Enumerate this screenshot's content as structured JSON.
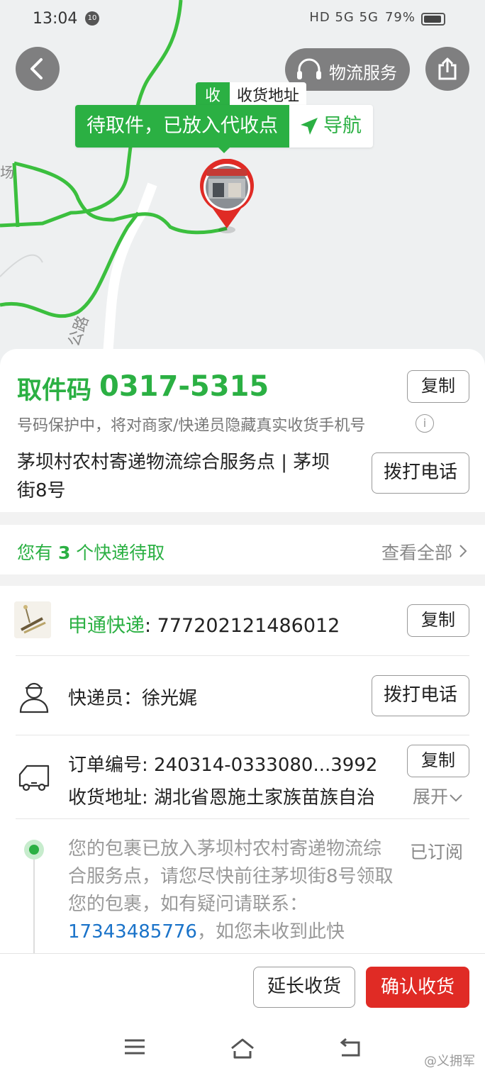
{
  "status_bar": {
    "time": "13:04",
    "notification_badge": "10",
    "system_indicators": "HD 5G 5G",
    "battery": "79%"
  },
  "map": {
    "service_label": "物流服务",
    "address_tag_key": "收",
    "address_tag_label": "收货地址",
    "status_text": "待取件，已放入代收点",
    "navigate_label": "导航",
    "road_label": "公路",
    "place_label": "场"
  },
  "pickup": {
    "code_label": "取件码",
    "code_value": "0317-5315",
    "copy_label": "复制",
    "privacy_note": "号码保护中，将对商家/快递员隐藏真实收货手机号",
    "station_name": "茅坝村农村寄递物流综合服务点 | 茅坝街8号",
    "call_label": "拨打电话"
  },
  "pending": {
    "prefix": "您有 ",
    "count": "3",
    "suffix": " 个快递待取",
    "view_all": "查看全部"
  },
  "shipment": {
    "carrier_name": "申通快递",
    "tracking_number": ": 777202121486012",
    "copy_label": "复制",
    "courier_text": "快递员：徐光娓",
    "call_label": "拨打电话",
    "order_text": "订单编号: 240314-0333080...3992",
    "order_copy_label": "复制",
    "address_text": "收货地址: 湖北省恩施土家族苗族自治",
    "expand_label": "展开",
    "track_text_1": "您的包裹已放入茅坝村农村寄递物流综合服务点，请您尽快前往茅坝街8号领取您的包裹，如有疑问请联系：",
    "track_phone": "17343485776",
    "track_text_2": "，如您未收到此快",
    "subscribed_label": "已订阅"
  },
  "actions": {
    "extend_label": "延长收货",
    "confirm_label": "确认收货"
  },
  "watermark": "@义拥军",
  "colors": {
    "accent_green": "#2bb043",
    "confirm_red": "#e02b25",
    "link_blue": "#1a73c9"
  }
}
